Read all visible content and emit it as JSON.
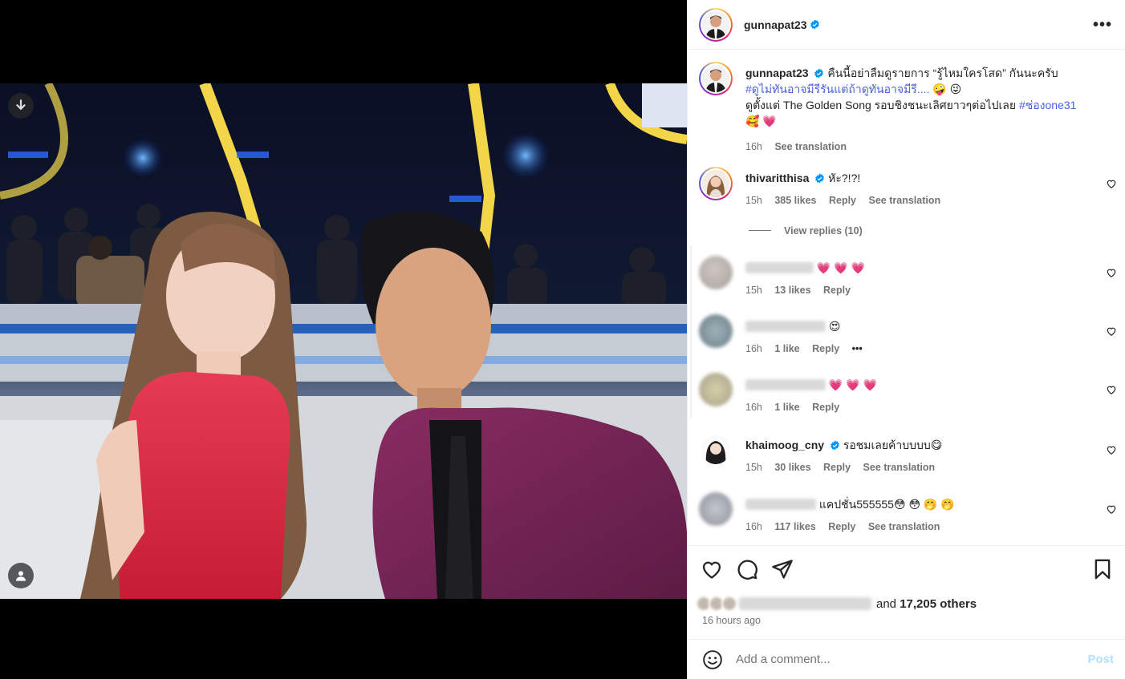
{
  "header": {
    "username": "gunnapat23",
    "more": "•••"
  },
  "caption": {
    "username": "gunnapat23",
    "line1": "คืนนี้อย่าลืมดูรายการ “รู้ไหมใครโสด” กันนะครับ",
    "hashtag1": "#ดูไม่ทันอาจมีรีรันแต่ถ้าดูทันอาจมีรี....",
    "emoji1": "🤪 😜",
    "line2": "ดูตั้งแต่ The Golden Song รอบชิงชนะเลิศยาวๆต่อไปเลย",
    "hashtag2": "#ช่องone31",
    "emoji2": "🥰 💗",
    "time": "16h",
    "see_translation": "See translation"
  },
  "comments": [
    {
      "username": "thivaritthisa",
      "verified": true,
      "text": "หัะ?!?!",
      "time": "15h",
      "likes": "385 likes",
      "reply": "Reply",
      "translation": "See translation"
    },
    {
      "username": "",
      "text": "💗 💗 💗",
      "time": "15h",
      "likes": "13 likes",
      "reply": "Reply"
    },
    {
      "username": "",
      "text": "😍",
      "time": "16h",
      "likes": "1 like",
      "reply": "Reply",
      "more": "•••"
    },
    {
      "username": "",
      "text": "💗 💗 💗",
      "time": "16h",
      "likes": "1 like",
      "reply": "Reply"
    },
    {
      "username": "khaimoog_cny",
      "verified": true,
      "text": "รอชมเลยค้าบบบบ😋",
      "time": "15h",
      "likes": "30 likes",
      "reply": "Reply",
      "translation": "See translation"
    },
    {
      "username": "",
      "text": "แคปชั่น555555😳 😳 🤭 🤭",
      "time": "16h",
      "likes": "117 likes",
      "reply": "Reply",
      "translation": "See translation"
    }
  ],
  "view_replies": "View replies (10)",
  "likes": {
    "and_text": "and",
    "count": "17,205 others"
  },
  "time_ago": "16 hours ago",
  "add_comment": {
    "placeholder": "Add a comment...",
    "post_label": "Post"
  },
  "colors": {
    "verified": "#0095f6",
    "hashtag": "#4a5fe0",
    "post_disabled": "#b2dffc"
  }
}
